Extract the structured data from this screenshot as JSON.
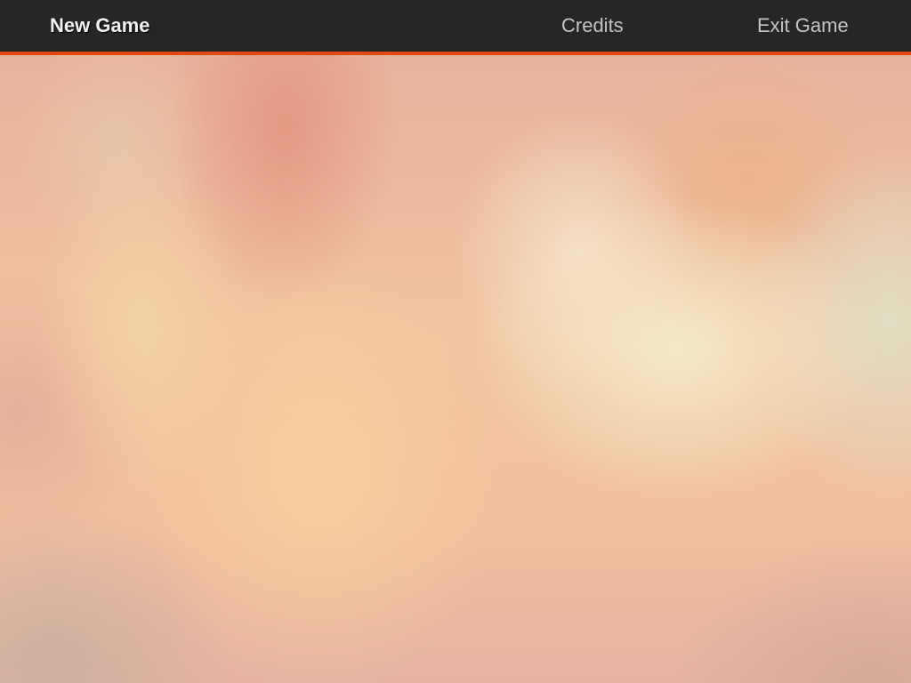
{
  "menu": {
    "items": [
      {
        "label": "New Game",
        "state": "active"
      },
      {
        "label": "Credits",
        "state": "inactive"
      },
      {
        "label": "Exit Game",
        "state": "inactive"
      }
    ]
  },
  "colors": {
    "menu_bar": "#262626",
    "accent_line": "#e24a10",
    "active_text": "#f2f2f2",
    "inactive_text": "#c4c4c4"
  }
}
